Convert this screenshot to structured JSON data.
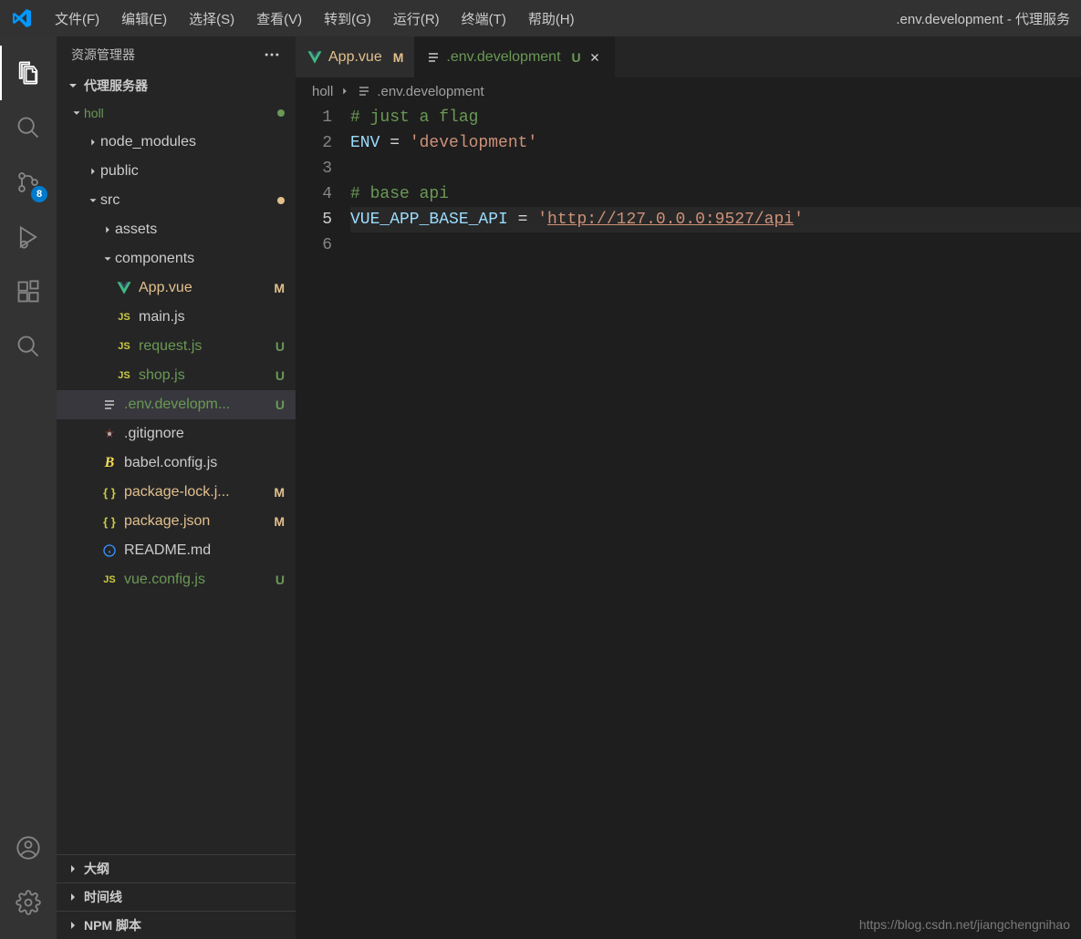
{
  "window_title": ".env.development - 代理服务",
  "menu": [
    "文件(F)",
    "编辑(E)",
    "选择(S)",
    "查看(V)",
    "转到(G)",
    "运行(R)",
    "终端(T)",
    "帮助(H)"
  ],
  "activity_badge": "8",
  "sidebar": {
    "title": "资源管理器",
    "sections": {
      "project": "代理服务器",
      "outline": "大纲",
      "timeline": "时间线",
      "npm": "NPM 脚本"
    }
  },
  "tree": {
    "root": "holl",
    "items": [
      {
        "name": "node_modules",
        "type": "folder-closed",
        "indent": 2
      },
      {
        "name": "public",
        "type": "folder-closed",
        "indent": 2
      },
      {
        "name": "src",
        "type": "folder-open",
        "indent": 2,
        "dot": "amber"
      },
      {
        "name": "assets",
        "type": "folder-closed",
        "indent": 3
      },
      {
        "name": "components",
        "type": "folder-open",
        "indent": 3
      },
      {
        "name": "App.vue",
        "type": "vue",
        "indent": 3,
        "status": "M"
      },
      {
        "name": "main.js",
        "type": "js",
        "indent": 3
      },
      {
        "name": "request.js",
        "type": "js",
        "indent": 3,
        "status": "U"
      },
      {
        "name": "shop.js",
        "type": "js",
        "indent": 3,
        "status": "U"
      },
      {
        "name": ".env.developm...",
        "type": "lines",
        "indent": 2,
        "status": "U",
        "selected": true
      },
      {
        "name": ".gitignore",
        "type": "git",
        "indent": 2
      },
      {
        "name": "babel.config.js",
        "type": "babel",
        "indent": 2
      },
      {
        "name": "package-lock.j...",
        "type": "json",
        "indent": 2,
        "status": "M"
      },
      {
        "name": "package.json",
        "type": "json",
        "indent": 2,
        "status": "M"
      },
      {
        "name": "README.md",
        "type": "info",
        "indent": 2
      },
      {
        "name": "vue.config.js",
        "type": "js",
        "indent": 2,
        "status": "U"
      }
    ]
  },
  "tabs": [
    {
      "label": "App.vue",
      "icon": "vue",
      "status": "M",
      "active": false
    },
    {
      "label": ".env.development",
      "icon": "lines",
      "status": "U",
      "active": true
    }
  ],
  "breadcrumbs": [
    "holl",
    ".env.development"
  ],
  "code": {
    "lines": [
      {
        "n": 1,
        "segments": [
          {
            "cls": "comment",
            "t": "# just a flag"
          }
        ]
      },
      {
        "n": 2,
        "segments": [
          {
            "cls": "tok-var",
            "t": "ENV"
          },
          {
            "cls": "",
            "t": " = "
          },
          {
            "cls": "tok-str",
            "t": "'development'"
          }
        ]
      },
      {
        "n": 3,
        "segments": []
      },
      {
        "n": 4,
        "segments": [
          {
            "cls": "comment",
            "t": "# base api"
          }
        ]
      },
      {
        "n": 5,
        "current": true,
        "segments": [
          {
            "cls": "tok-var",
            "t": "VUE_APP_BASE_API"
          },
          {
            "cls": "",
            "t": " = "
          },
          {
            "cls": "tok-str",
            "t": "'"
          },
          {
            "cls": "tok-url",
            "t": "http://127.0.0.0:9527/api"
          },
          {
            "cls": "tok-str",
            "t": "'"
          }
        ]
      },
      {
        "n": 6,
        "segments": []
      }
    ]
  },
  "watermark": "https://blog.csdn.net/jiangchengnihao"
}
